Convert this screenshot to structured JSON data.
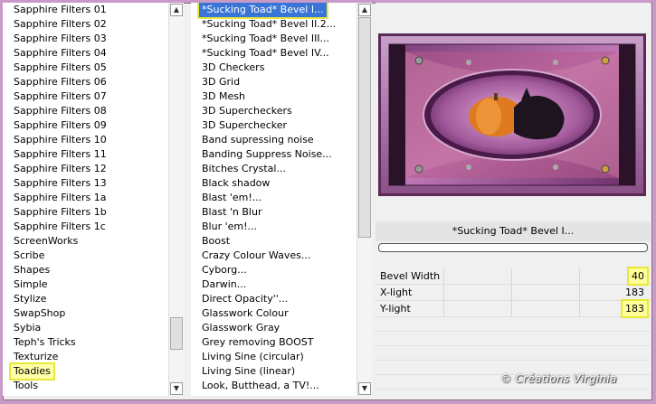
{
  "categories": {
    "items": [
      "Sapphire Filters 01",
      "Sapphire Filters 02",
      "Sapphire Filters 03",
      "Sapphire Filters 04",
      "Sapphire Filters 05",
      "Sapphire Filters 06",
      "Sapphire Filters 07",
      "Sapphire Filters 08",
      "Sapphire Filters 09",
      "Sapphire Filters 10",
      "Sapphire Filters 11",
      "Sapphire Filters 12",
      "Sapphire Filters 13",
      "Sapphire Filters 1a",
      "Sapphire Filters 1b",
      "Sapphire Filters 1c",
      "ScreenWorks",
      "Scribe",
      "Shapes",
      "Simple",
      "Stylize",
      "SwapShop",
      "Sybia",
      "Teph's Tricks",
      "Texturize",
      "Toadies",
      "Tools"
    ],
    "selected": "Toadies"
  },
  "filters": {
    "items": [
      "*Sucking Toad*  Bevel I...",
      "*Sucking Toad*  Bevel II.2...",
      "*Sucking Toad*  Bevel III...",
      "*Sucking Toad*  Bevel IV...",
      "3D Checkers",
      "3D Grid",
      "3D Mesh",
      "3D Supercheckers",
      "3D Superchecker",
      "Band supressing noise",
      "Banding Suppress Noise...",
      "Bitches Crystal...",
      "Black shadow",
      "Blast 'em!...",
      "Blast 'n Blur",
      "Blur 'em!...",
      "Boost",
      "Crazy Colour Waves...",
      "Cyborg...",
      "Darwin...",
      "Direct Opacity''...",
      "Glasswork Colour",
      "Glasswork Gray",
      "Grey removing BOOST",
      "Living Sine (circular)",
      "Living Sine (linear)",
      "Look, Butthead, a TV!..."
    ],
    "selected": "*Sucking Toad*  Bevel I..."
  },
  "panel": {
    "filter_name": "*Sucking Toad*  Bevel I...",
    "params": [
      {
        "label": "Bevel Width",
        "value": "40",
        "highlight": true
      },
      {
        "label": "X-light",
        "value": "183",
        "highlight": false
      },
      {
        "label": "Y-light",
        "value": "183",
        "highlight": true
      }
    ]
  },
  "watermark": "© Créations Virginia",
  "colors": {
    "background": "#c89ac8",
    "selection": "#3875d7",
    "highlight": "#e8e83a"
  }
}
